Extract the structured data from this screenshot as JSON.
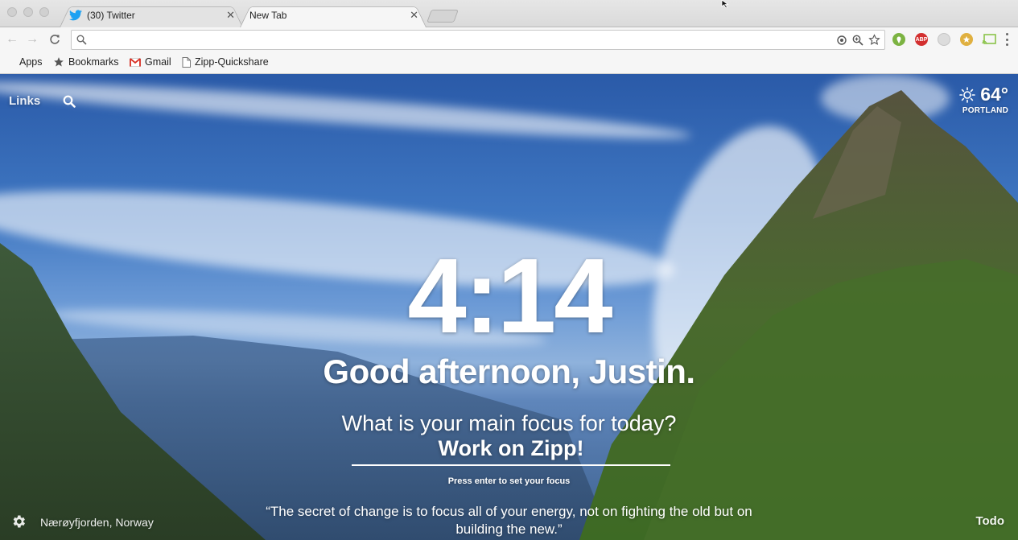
{
  "tabs": [
    {
      "title": "(30) Twitter",
      "favicon": "twitter-bird-icon",
      "active": false
    },
    {
      "title": "New Tab",
      "active": true
    }
  ],
  "omnibox": {
    "value": ""
  },
  "bookmarks": [
    {
      "label": "Apps",
      "icon": "apps-grid-icon"
    },
    {
      "label": "Bookmarks",
      "icon": "star-icon"
    },
    {
      "label": "Gmail",
      "icon": "gmail-icon"
    },
    {
      "label": "Zipp-Quickshare",
      "icon": "page-icon"
    }
  ],
  "extensions": [
    {
      "name": "location-ext-icon",
      "color": "#7cb342"
    },
    {
      "name": "adblock-plus-icon",
      "text": "ABP",
      "color": "#d32f2f"
    },
    {
      "name": "ext-grey-icon",
      "color": "#cfcfcf"
    },
    {
      "name": "ext-star-icon",
      "color": "#e0b040"
    },
    {
      "name": "cast-icon",
      "color": "#8bc34a"
    }
  ],
  "momentum": {
    "links_label": "Links",
    "weather": {
      "temperature": "64°",
      "city": "PORTLAND",
      "icon": "sun-icon"
    },
    "time": "4:14",
    "greeting": "Good afternoon, Justin.",
    "focus_question": "What is your main focus for today?",
    "focus_value": "Work on Zipp!",
    "focus_hint": "Press enter to set your focus",
    "quote": "“The secret of change is to focus all of your energy, not on fighting the old but on building the new.”",
    "photo_location": "Nærøyfjorden, Norway",
    "todo_label": "Todo"
  }
}
